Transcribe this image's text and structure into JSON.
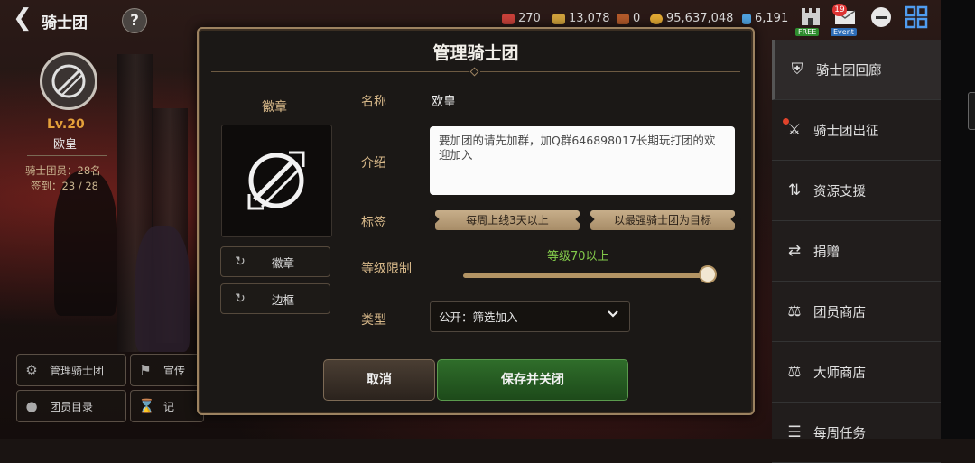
{
  "topbar": {
    "title": "骑士团",
    "help": "?",
    "resources": [
      {
        "icon": "red-gem-icon",
        "value": "270",
        "color": "#c9413a"
      },
      {
        "icon": "gold-bar-icon",
        "value": "13,078",
        "color": "#d0a23c"
      },
      {
        "icon": "ore-icon",
        "value": "0",
        "color": "#b35a2a"
      },
      {
        "icon": "gold-coin-icon",
        "value": "95,637,048",
        "color": "#e2a933"
      },
      {
        "icon": "crystal-icon",
        "value": "6,191",
        "color": "#4fa2e0"
      }
    ],
    "free_label": "FREE",
    "event_label": "Event",
    "notification_count": "19"
  },
  "guild": {
    "level": "Lv.20",
    "name": "欧皇",
    "members": "骑士团员：28名",
    "checkin": "签到：23 / 28"
  },
  "left_buttons": {
    "manage": "管理骑士团",
    "promote": "宣传",
    "roster": "团员目录",
    "record": "记"
  },
  "sidebar": {
    "items": [
      {
        "label": "骑士团回廊",
        "icon": "shield-icon"
      },
      {
        "label": "骑士团出征",
        "icon": "crossed-swords-icon"
      },
      {
        "label": "资源支援",
        "icon": "support-icon"
      },
      {
        "label": "捐赠",
        "icon": "shuffle-icon"
      },
      {
        "label": "团员商店",
        "icon": "scale-icon"
      },
      {
        "label": "大师商店",
        "icon": "master-scale-icon"
      },
      {
        "label": "每周任务",
        "icon": "weekly-task-icon"
      }
    ]
  },
  "modal": {
    "title": "管理骑士团",
    "emblem_section": "徽章",
    "emblem_button": "徽章",
    "frame_button": "边框",
    "name_label": "名称",
    "name_value": "欧皇",
    "intro_label": "介绍",
    "intro_value": "要加团的请先加群，加Q群646898017长期玩打团的欢迎加入",
    "tags_label": "标签",
    "tags": [
      "每周上线3天以上",
      "以最强骑士团为目标"
    ],
    "level_label": "等级限制",
    "level_value": "等级70以上",
    "level_fill": 1.0,
    "type_label": "类型",
    "type_value": "公开：筛选加入",
    "cancel": "取消",
    "save": "保存并关闭"
  }
}
